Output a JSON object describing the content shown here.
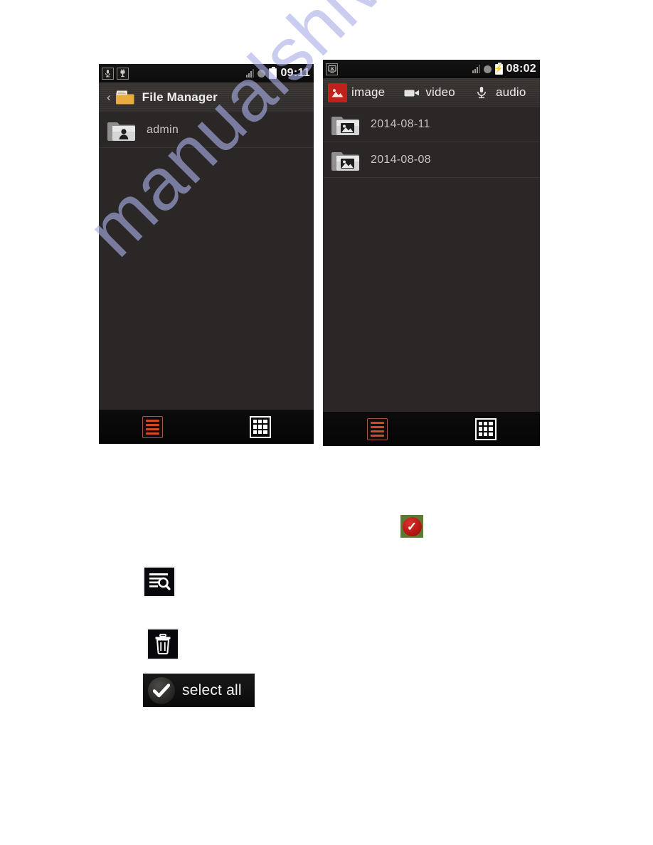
{
  "watermark": {
    "text": "manualshive.com"
  },
  "phone_left": {
    "status_bar": {
      "time": "09:11",
      "notification_icons": [
        "microphone-icon",
        "usb-plug-icon"
      ],
      "system_icons": [
        "signal-icon",
        "alarm-icon",
        "battery-icon"
      ]
    },
    "action_bar": {
      "back_label": "‹",
      "icon": "folder-icon",
      "title": "File Manager"
    },
    "list": [
      {
        "icon": "folder-user-icon",
        "label": "admin"
      }
    ],
    "toolbar": [
      {
        "icon": "list-view-icon",
        "state": "selected"
      },
      {
        "icon": "grid-view-icon",
        "state": "normal"
      }
    ]
  },
  "phone_right": {
    "status_bar": {
      "time": "08:02",
      "notification_icons": [
        "screen-disconnect-icon"
      ],
      "system_icons": [
        "signal-icon",
        "alarm-icon",
        "battery-charging-icon"
      ]
    },
    "tabs": [
      {
        "label": "image",
        "icon": "image-icon",
        "active": true
      },
      {
        "label": "video",
        "icon": "video-camera-icon",
        "active": false
      },
      {
        "label": "audio",
        "icon": "microphone-icon",
        "active": false
      }
    ],
    "list": [
      {
        "icon": "folder-image-icon",
        "label": "2014-08-11"
      },
      {
        "icon": "folder-image-icon",
        "label": "2014-08-08"
      }
    ],
    "toolbar": [
      {
        "icon": "list-view-icon",
        "state": "selected"
      },
      {
        "icon": "grid-view-icon",
        "state": "normal"
      }
    ]
  },
  "legend": {
    "search_icon_name": "search-list-icon",
    "trash_icon_name": "trash-icon",
    "check_badge_name": "selected-check-badge",
    "select_all": {
      "label": "select all",
      "icon": "checkmark-icon"
    }
  },
  "colors": {
    "accent_red": "#c0211c",
    "toolbar_orange": "#cf4a24",
    "watermark_blue": "#aab0e8"
  }
}
